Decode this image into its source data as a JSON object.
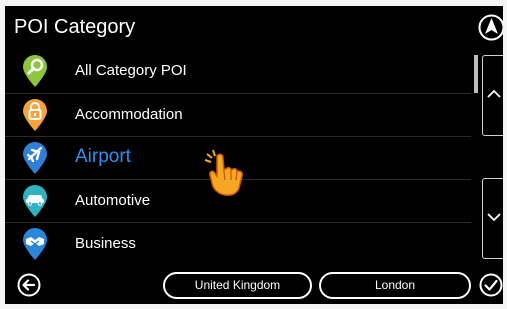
{
  "header": {
    "title": "POI Category"
  },
  "categories": [
    {
      "label": "All Category POI",
      "icon": "search-icon",
      "color": "#8cc63f",
      "selected": false
    },
    {
      "label": "Accommodation",
      "icon": "lock-icon",
      "color": "#f7a33a",
      "selected": false
    },
    {
      "label": "Airport",
      "icon": "airplane-icon",
      "color": "#2f7fd6",
      "selected": true
    },
    {
      "label": "Automotive",
      "icon": "car-icon",
      "color": "#2fb3c0",
      "selected": false
    },
    {
      "label": "Business",
      "icon": "handshake-icon",
      "color": "#2a86d8",
      "selected": false
    }
  ],
  "footer": {
    "country": "United Kingdom",
    "city": "London"
  },
  "colors": {
    "selected_text": "#2f8ef0",
    "background": "#000000"
  }
}
